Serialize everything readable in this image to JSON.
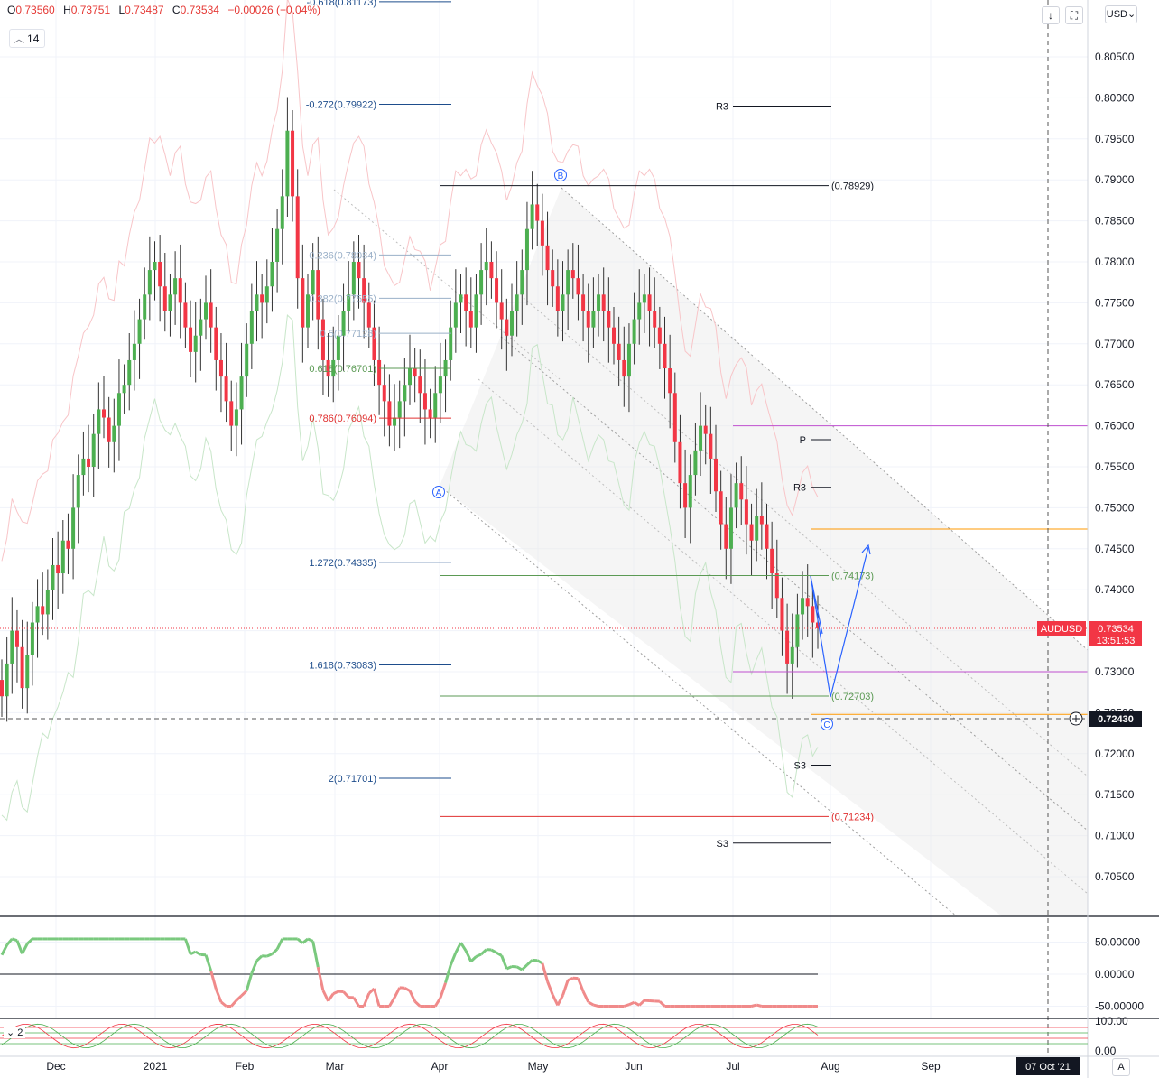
{
  "legend": {
    "open_label": "O",
    "open": "0.73560",
    "high_label": "H",
    "high": "0.73751",
    "low_label": "L",
    "low": "0.73487",
    "close_label": "C",
    "close": "0.73534",
    "change": "−0.00026 (−0.04%)",
    "interval": "14",
    "indicator2": "2"
  },
  "toolbar": {
    "down_icon": "arrow-down-icon",
    "fullscreen_icon": "fullscreen-icon",
    "currency": "USD",
    "auto_label": "A"
  },
  "colors": {
    "bull": "#4caf50",
    "bear": "#f23645",
    "fib_blue": "#1e4d8c",
    "fib_green": "#5b9a54",
    "fib_red": "#e03030",
    "magenta": "#c050d0",
    "orange": "#ff9800",
    "channel": "#e6e6e6",
    "price_tag": "#f23645"
  },
  "chart_data": [
    {
      "type": "candlestick",
      "symbol": "AUDUSD",
      "ylim": [
        0.7,
        0.81173
      ],
      "y_ticks": [
        "0.80500",
        "0.80000",
        "0.79500",
        "0.79000",
        "0.78500",
        "0.78000",
        "0.77500",
        "0.77000",
        "0.76500",
        "0.76000",
        "0.75500",
        "0.75000",
        "0.74500",
        "0.74000",
        "0.73500",
        "0.73000",
        "0.72500",
        "0.72000",
        "0.71500",
        "0.71000",
        "0.70500"
      ],
      "x_ticks": [
        "Dec",
        "2021",
        "Feb",
        "Mar",
        "Apr",
        "May",
        "Jun",
        "Jul",
        "Aug",
        "Sep",
        "07 Oct '21"
      ],
      "last_price": "0.73534",
      "countdown": "13:51:53",
      "crosshair_price": "0.72430",
      "closes": [
        0.727,
        0.731,
        0.735,
        0.733,
        0.728,
        0.732,
        0.736,
        0.738,
        0.737,
        0.74,
        0.743,
        0.742,
        0.746,
        0.745,
        0.75,
        0.754,
        0.756,
        0.755,
        0.759,
        0.762,
        0.761,
        0.758,
        0.76,
        0.764,
        0.765,
        0.768,
        0.77,
        0.773,
        0.776,
        0.779,
        0.78,
        0.777,
        0.774,
        0.776,
        0.778,
        0.775,
        0.772,
        0.769,
        0.771,
        0.773,
        0.775,
        0.772,
        0.768,
        0.766,
        0.763,
        0.76,
        0.762,
        0.766,
        0.77,
        0.774,
        0.776,
        0.775,
        0.777,
        0.78,
        0.784,
        0.788,
        0.796,
        0.788,
        0.778,
        0.772,
        0.776,
        0.779,
        0.773,
        0.768,
        0.766,
        0.768,
        0.771,
        0.774,
        0.776,
        0.78,
        0.778,
        0.775,
        0.772,
        0.768,
        0.765,
        0.763,
        0.76,
        0.761,
        0.763,
        0.765,
        0.767,
        0.766,
        0.764,
        0.762,
        0.761,
        0.764,
        0.766,
        0.768,
        0.772,
        0.775,
        0.776,
        0.774,
        0.772,
        0.776,
        0.779,
        0.78,
        0.778,
        0.775,
        0.773,
        0.771,
        0.774,
        0.776,
        0.779,
        0.784,
        0.787,
        0.785,
        0.782,
        0.779,
        0.777,
        0.774,
        0.776,
        0.779,
        0.778,
        0.776,
        0.774,
        0.772,
        0.774,
        0.776,
        0.774,
        0.772,
        0.77,
        0.768,
        0.766,
        0.77,
        0.773,
        0.775,
        0.776,
        0.774,
        0.772,
        0.77,
        0.767,
        0.764,
        0.758,
        0.753,
        0.75,
        0.754,
        0.757,
        0.76,
        0.759,
        0.756,
        0.752,
        0.748,
        0.745,
        0.75,
        0.753,
        0.751,
        0.748,
        0.746,
        0.749,
        0.748,
        0.745,
        0.742,
        0.739,
        0.735,
        0.731,
        0.733,
        0.737,
        0.739,
        0.738,
        0.736,
        0.7353
      ],
      "fib_levels": [
        {
          "label": "-0.618(0.81173)",
          "value": 0.81173,
          "style": "blue"
        },
        {
          "label": "-0.272(0.79922)",
          "value": 0.79922,
          "style": "blue"
        },
        {
          "label": "0.236(0.78084)",
          "value": 0.78084,
          "style": "faded"
        },
        {
          "label": "0.382(0.77555)",
          "value": 0.77555,
          "style": "faded"
        },
        {
          "label": "0.5(0.77128)",
          "value": 0.77128,
          "style": "faded"
        },
        {
          "label": "0.618(0.76701)",
          "value": 0.76701,
          "style": "green"
        },
        {
          "label": "0.786(0.76094)",
          "value": 0.76094,
          "style": "red"
        },
        {
          "label": "1.272(0.74335)",
          "value": 0.74335,
          "style": "blue"
        },
        {
          "label": "1.618(0.73083)",
          "value": 0.73083,
          "style": "blue"
        },
        {
          "label": "2(0.71701)",
          "value": 0.71701,
          "style": "blue"
        }
      ],
      "projection_levels": [
        {
          "label": "(0.78929)",
          "value": 0.78929,
          "style": "black"
        },
        {
          "label": "(0.74173)",
          "value": 0.74173,
          "style": "green"
        },
        {
          "label": "(0.72703)",
          "value": 0.72703,
          "style": "green"
        },
        {
          "label": "(0.71234)",
          "value": 0.71234,
          "style": "red"
        }
      ],
      "pivots": [
        {
          "label": "R3",
          "value": 0.799
        },
        {
          "label": "P",
          "value": 0.7583
        },
        {
          "label": "R3",
          "value": 0.7525
        },
        {
          "label": "S3",
          "value": 0.7186
        },
        {
          "label": "S3",
          "value": 0.7091
        }
      ],
      "wave_labels": [
        "A",
        "B",
        "C"
      ],
      "hlines": [
        {
          "value": 0.76,
          "color": "magenta"
        },
        {
          "value": 0.73,
          "color": "magenta"
        },
        {
          "value": 0.7474,
          "color": "orange"
        },
        {
          "value": 0.7248,
          "color": "orange"
        }
      ]
    },
    {
      "type": "line",
      "name": "oscillator",
      "ylim": [
        -55,
        60
      ],
      "y_ticks": [
        "50.00000",
        "0.00000",
        "-50.00000"
      ]
    },
    {
      "type": "line",
      "name": "indicator 2",
      "ylim": [
        0,
        100
      ],
      "y_ticks": [
        "100.00",
        "0.00"
      ]
    }
  ]
}
